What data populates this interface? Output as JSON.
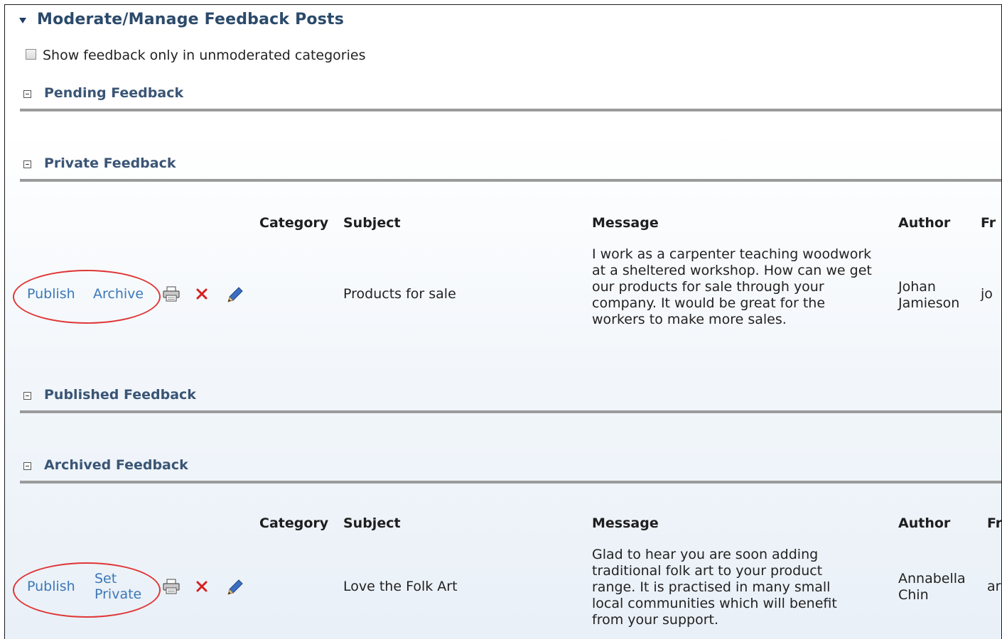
{
  "title": "Moderate/Manage Feedback Posts",
  "filter": {
    "label": "Show feedback only in unmoderated categories",
    "checked": false
  },
  "sections": {
    "pending": {
      "label": "Pending Feedback"
    },
    "private": {
      "label": "Private Feedback",
      "columns": {
        "category": "Category",
        "subject": "Subject",
        "message": "Message",
        "author": "Author",
        "from": "Fr"
      },
      "row": {
        "actions": [
          "Publish",
          "Archive"
        ],
        "subject": "Products for sale",
        "message": "I work as a carpenter teaching woodwork at a sheltered workshop. How can we get our products for sale through your company. It would be great for the workers to make more sales.",
        "author": "Johan Jamieson",
        "from": "jo"
      }
    },
    "published": {
      "label": "Published Feedback"
    },
    "archived": {
      "label": "Archived Feedback",
      "columns": {
        "category": "Category",
        "subject": "Subject",
        "message": "Message",
        "author": "Author",
        "from": "Fr"
      },
      "row": {
        "actions": [
          "Publish",
          "Set Private"
        ],
        "subject": "Love the Folk Art",
        "message": "Glad to hear you are soon adding traditional folk art to your product range. It is practised in many small local communities which will benefit from your support.",
        "author": "Annabella Chin",
        "from": "ar"
      }
    }
  },
  "icons": {
    "print": "printer-icon",
    "delete": "delete-x-icon",
    "edit": "pencil-icon"
  },
  "colors": {
    "link": "#3a78b8",
    "section": "#3a5575",
    "title": "#2b4a6b",
    "annotation": "#e03535",
    "delete": "#d62020"
  }
}
